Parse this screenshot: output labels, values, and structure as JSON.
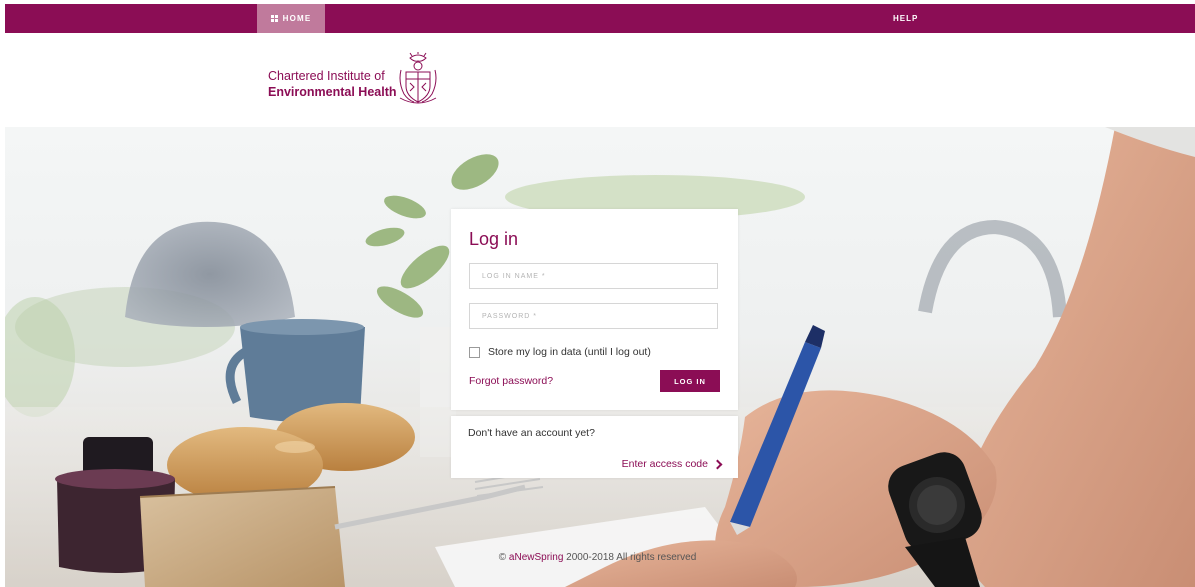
{
  "nav": {
    "home_label": "HOME",
    "help_label": "HELP"
  },
  "logo": {
    "line1": "Chartered Institute of",
    "line2": "Environmental Health"
  },
  "login": {
    "title": "Log in",
    "username_placeholder": "LOG IN NAME *",
    "password_placeholder": "PASSWORD *",
    "remember_label": "Store my log in data (until I log out)",
    "forgot_label": "Forgot password?",
    "submit_label": "LOG IN"
  },
  "access": {
    "question": "Don't have an account yet?",
    "link_label": "Enter access code"
  },
  "footer": {
    "copyright_symbol": "©",
    "brand": "aNewSpring",
    "rights": "2000-2018 All rights reserved"
  },
  "icons": {
    "home": "grid-icon",
    "crest": "crest-icon",
    "chevron": "chevron-right-icon"
  },
  "colors": {
    "brand": "#8b0d55",
    "nav_active": "#c07a9c"
  }
}
